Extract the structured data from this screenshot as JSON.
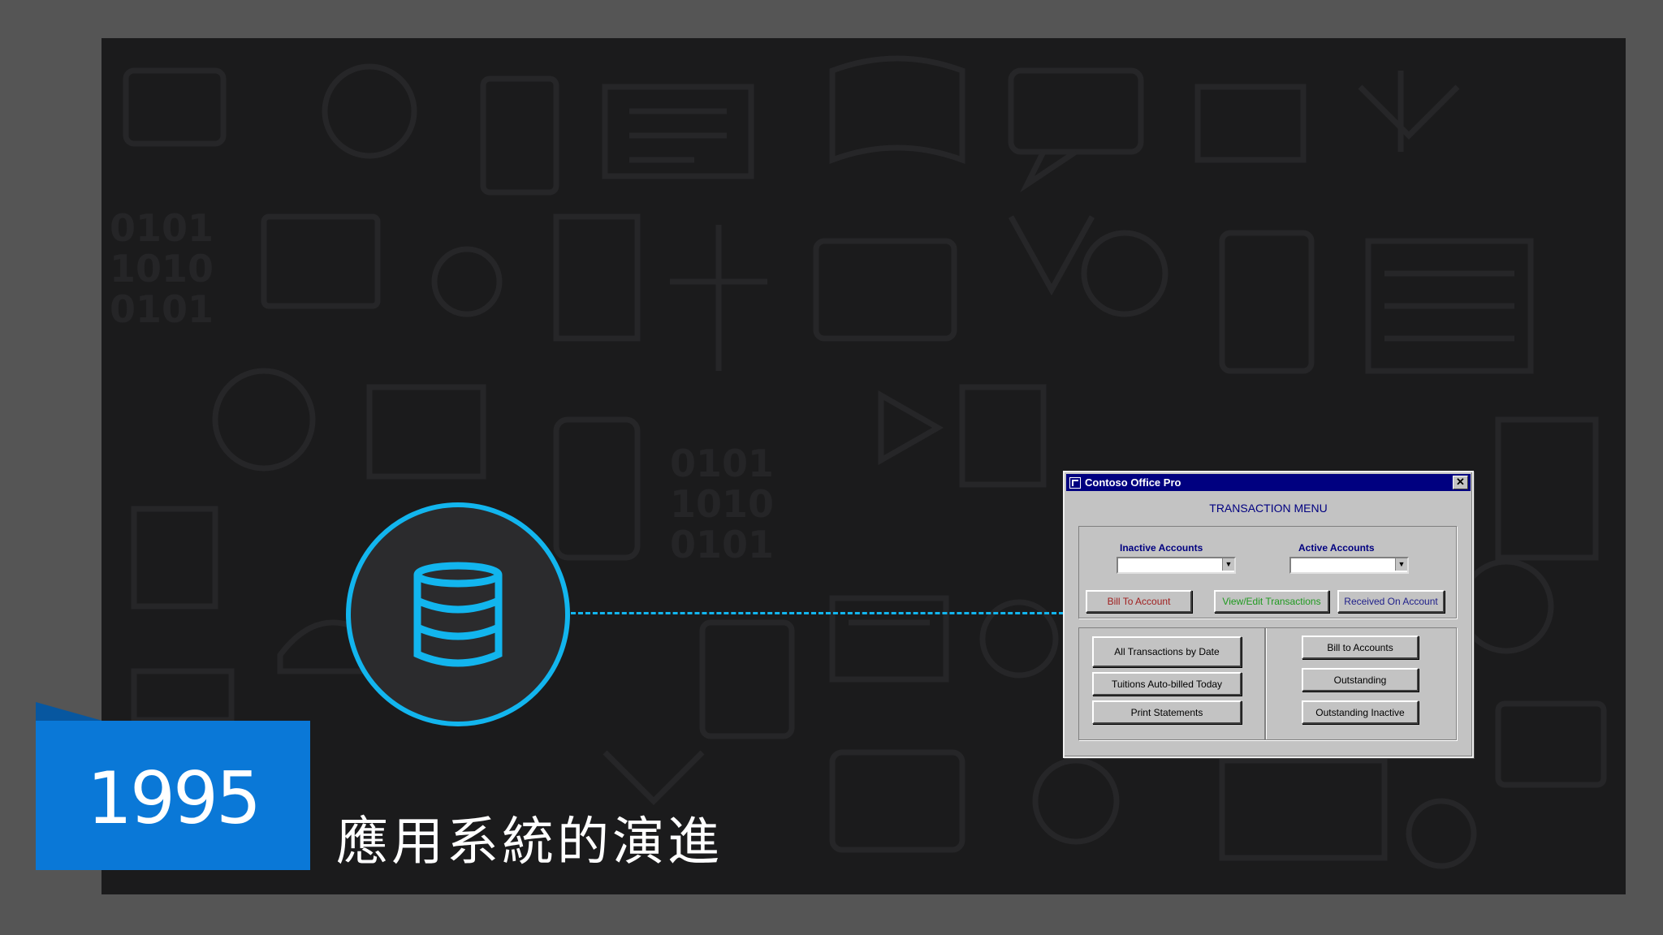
{
  "slide": {
    "year": "1995",
    "subtitle": "應用系統的演進"
  },
  "colors": {
    "accent_blue": "#0a78d7",
    "ring_cyan": "#12b5ee",
    "titlebar_navy": "#000080"
  },
  "icons": {
    "database": "database-icon"
  },
  "window": {
    "title": "Contoso Office Pro",
    "close_label": "✕",
    "menu_title": "TRANSACTION MENU",
    "inactive_label": "Inactive Accounts",
    "active_label": "Active Accounts",
    "inactive_value": "",
    "active_value": "",
    "buttons_top": [
      {
        "label": "Bill To Account",
        "color": "#a02020"
      },
      {
        "label": "View/Edit Transactions",
        "color": "#1f9a1f"
      },
      {
        "label": "Received On Account",
        "color": "#20208a"
      }
    ],
    "buttons_left": [
      "All Transactions by Date",
      "Tuitions Auto-billed Today",
      "Print Statements"
    ],
    "buttons_right": [
      "Bill to Accounts",
      "Outstanding",
      "Outstanding Inactive"
    ]
  }
}
